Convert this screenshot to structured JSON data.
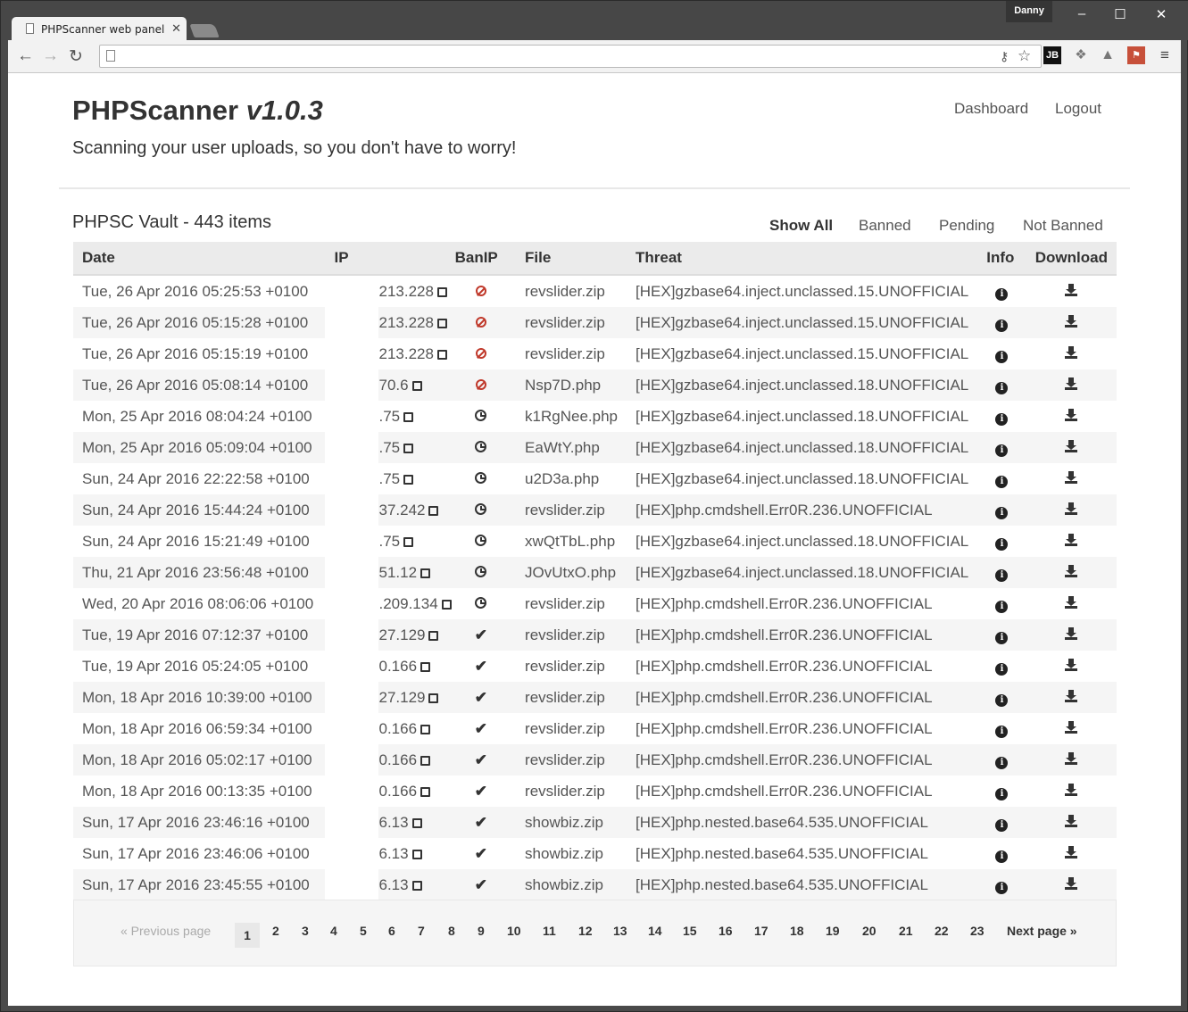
{
  "browser": {
    "tab_title": "PHPScanner web panel",
    "tab_close": "✕",
    "user": "Danny",
    "extensions": [
      "JB"
    ]
  },
  "header": {
    "brand": "PHPScanner",
    "version": "v1.0.3",
    "tagline": "Scanning your user uploads, so you don't have to worry!",
    "nav": [
      "Dashboard",
      "Logout"
    ]
  },
  "vault": {
    "title": "PHPSC Vault - 443 items",
    "filters": [
      "Show All",
      "Banned",
      "Pending",
      "Not Banned"
    ],
    "active_filter": "Show All",
    "columns": [
      "Date",
      "IP",
      "BanIP",
      "File",
      "Threat",
      "Info",
      "Download"
    ],
    "rows": [
      {
        "date": "Tue, 26 Apr 2016 05:25:53 +0100",
        "ip": "213.228",
        "status": "banned",
        "file": "revslider.zip",
        "threat": "[HEX]gzbase64.inject.unclassed.15.UNOFFICIAL"
      },
      {
        "date": "Tue, 26 Apr 2016 05:15:28 +0100",
        "ip": "213.228",
        "status": "banned",
        "file": "revslider.zip",
        "threat": "[HEX]gzbase64.inject.unclassed.15.UNOFFICIAL"
      },
      {
        "date": "Tue, 26 Apr 2016 05:15:19 +0100",
        "ip": "213.228",
        "status": "banned",
        "file": "revslider.zip",
        "threat": "[HEX]gzbase64.inject.unclassed.15.UNOFFICIAL"
      },
      {
        "date": "Tue, 26 Apr 2016 05:08:14 +0100",
        "ip": "70.6",
        "status": "banned",
        "file": "Nsp7D.php",
        "threat": "[HEX]gzbase64.inject.unclassed.18.UNOFFICIAL"
      },
      {
        "date": "Mon, 25 Apr 2016 08:04:24 +0100",
        "ip": ".75",
        "status": "pending",
        "file": "k1RgNee.php",
        "threat": "[HEX]gzbase64.inject.unclassed.18.UNOFFICIAL"
      },
      {
        "date": "Mon, 25 Apr 2016 05:09:04 +0100",
        "ip": ".75",
        "status": "pending",
        "file": "EaWtY.php",
        "threat": "[HEX]gzbase64.inject.unclassed.18.UNOFFICIAL"
      },
      {
        "date": "Sun, 24 Apr 2016 22:22:58 +0100",
        "ip": ".75",
        "status": "pending",
        "file": "u2D3a.php",
        "threat": "[HEX]gzbase64.inject.unclassed.18.UNOFFICIAL"
      },
      {
        "date": "Sun, 24 Apr 2016 15:44:24 +0100",
        "ip": "37.242",
        "status": "pending",
        "file": "revslider.zip",
        "threat": "[HEX]php.cmdshell.Err0R.236.UNOFFICIAL"
      },
      {
        "date": "Sun, 24 Apr 2016 15:21:49 +0100",
        "ip": ".75",
        "status": "pending",
        "file": "xwQtTbL.php",
        "threat": "[HEX]gzbase64.inject.unclassed.18.UNOFFICIAL"
      },
      {
        "date": "Thu, 21 Apr 2016 23:56:48 +0100",
        "ip": "51.12",
        "status": "pending",
        "file": "JOvUtxO.php",
        "threat": "[HEX]gzbase64.inject.unclassed.18.UNOFFICIAL"
      },
      {
        "date": "Wed, 20 Apr 2016 08:06:06 +0100",
        "ip": ".209.134",
        "status": "pending",
        "file": "revslider.zip",
        "threat": "[HEX]php.cmdshell.Err0R.236.UNOFFICIAL"
      },
      {
        "date": "Tue, 19 Apr 2016 07:12:37 +0100",
        "ip": "27.129",
        "status": "notbanned",
        "file": "revslider.zip",
        "threat": "[HEX]php.cmdshell.Err0R.236.UNOFFICIAL"
      },
      {
        "date": "Tue, 19 Apr 2016 05:24:05 +0100",
        "ip": "0.166",
        "status": "notbanned",
        "file": "revslider.zip",
        "threat": "[HEX]php.cmdshell.Err0R.236.UNOFFICIAL"
      },
      {
        "date": "Mon, 18 Apr 2016 10:39:00 +0100",
        "ip": "27.129",
        "status": "notbanned",
        "file": "revslider.zip",
        "threat": "[HEX]php.cmdshell.Err0R.236.UNOFFICIAL"
      },
      {
        "date": "Mon, 18 Apr 2016 06:59:34 +0100",
        "ip": "0.166",
        "status": "notbanned",
        "file": "revslider.zip",
        "threat": "[HEX]php.cmdshell.Err0R.236.UNOFFICIAL"
      },
      {
        "date": "Mon, 18 Apr 2016 05:02:17 +0100",
        "ip": "0.166",
        "status": "notbanned",
        "file": "revslider.zip",
        "threat": "[HEX]php.cmdshell.Err0R.236.UNOFFICIAL"
      },
      {
        "date": "Mon, 18 Apr 2016 00:13:35 +0100",
        "ip": "0.166",
        "status": "notbanned",
        "file": "revslider.zip",
        "threat": "[HEX]php.cmdshell.Err0R.236.UNOFFICIAL"
      },
      {
        "date": "Sun, 17 Apr 2016 23:46:16 +0100",
        "ip": "6.13",
        "status": "notbanned",
        "file": "showbiz.zip",
        "threat": "[HEX]php.nested.base64.535.UNOFFICIAL"
      },
      {
        "date": "Sun, 17 Apr 2016 23:46:06 +0100",
        "ip": "6.13",
        "status": "notbanned",
        "file": "showbiz.zip",
        "threat": "[HEX]php.nested.base64.535.UNOFFICIAL"
      },
      {
        "date": "Sun, 17 Apr 2016 23:45:55 +0100",
        "ip": "6.13",
        "status": "notbanned",
        "file": "showbiz.zip",
        "threat": "[HEX]php.nested.base64.535.UNOFFICIAL"
      }
    ]
  },
  "pagination": {
    "prev": "« Previous page",
    "next": "Next page »",
    "pages": [
      "1",
      "2",
      "3",
      "4",
      "5",
      "6",
      "7",
      "8",
      "9",
      "10",
      "11",
      "12",
      "13",
      "14",
      "15",
      "16",
      "17",
      "18",
      "19",
      "20",
      "21",
      "22",
      "23"
    ],
    "current": "1"
  },
  "colors": {
    "ban": "#c0392b",
    "row_alt": "#f5f5f5",
    "header_bg": "#ebebeb"
  }
}
